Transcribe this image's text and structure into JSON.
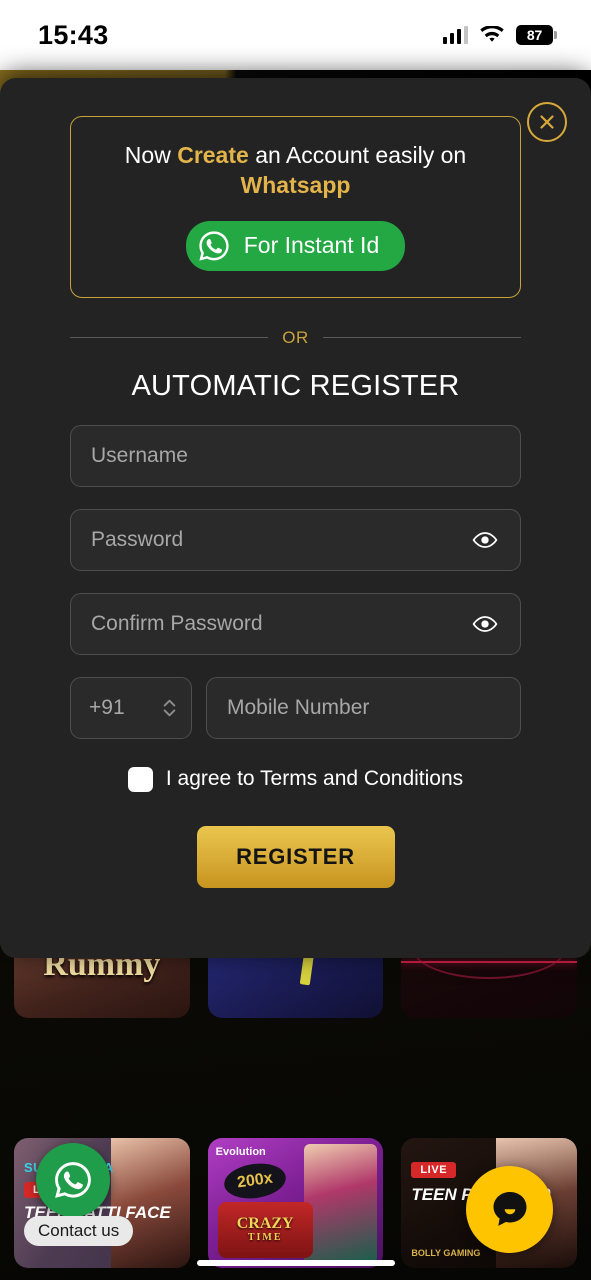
{
  "status_bar": {
    "time": "15:43",
    "battery_level": "87",
    "icons": [
      "cellular-signal-icon",
      "wifi-icon",
      "battery-icon"
    ]
  },
  "modal": {
    "close_icon": "close-circle-icon",
    "promo": {
      "line1_pre": "Now ",
      "line1_highlight": "Create",
      "line1_post": " an Account easily on",
      "line2": "Whatsapp",
      "button_label": "For Instant Id",
      "button_icon": "whatsapp-icon",
      "border_color": "#c9a23c",
      "button_color": "#24a844"
    },
    "divider_label": "OR",
    "form_title": "AUTOMATIC REGISTER",
    "fields": {
      "username": {
        "placeholder": "Username",
        "value": ""
      },
      "password": {
        "placeholder": "Password",
        "value": "",
        "toggle_icon": "eye-icon"
      },
      "confirm_password": {
        "placeholder": "Confirm Password",
        "value": "",
        "toggle_icon": "eye-icon"
      },
      "country_code": {
        "value": "+91",
        "icon": "chevron-updown-icon"
      },
      "mobile_number": {
        "placeholder": "Mobile Number",
        "value": ""
      }
    },
    "terms": {
      "label": "I agree to Terms and Conditions",
      "checked": false
    },
    "submit_label": "REGISTER",
    "submit_color": "#dbb03a"
  },
  "background": {
    "game_tiles_row1": [
      {
        "name": "Rummy",
        "label": "Rummy"
      },
      {
        "name": "blue-game-tile",
        "label": ""
      },
      {
        "name": "dark-game-tile",
        "label": ""
      }
    ],
    "game_tiles_row2": [
      {
        "brand": "SUPERNOWA",
        "live": "LIVE",
        "title": "TEEN PATTI FACE"
      },
      {
        "brand": "Evolution",
        "multiplier": "200x",
        "title": "CRAZY",
        "subtitle": "TIME"
      },
      {
        "brand": "BOLLY GAMING",
        "live": "LIVE",
        "title": "TEEN PATTI 2020"
      }
    ]
  },
  "floating": {
    "whatsapp_label": "Contact us",
    "whatsapp_icon": "whatsapp-icon",
    "chat_icon": "chat-bubble-icon",
    "chat_color": "#ffc400"
  }
}
